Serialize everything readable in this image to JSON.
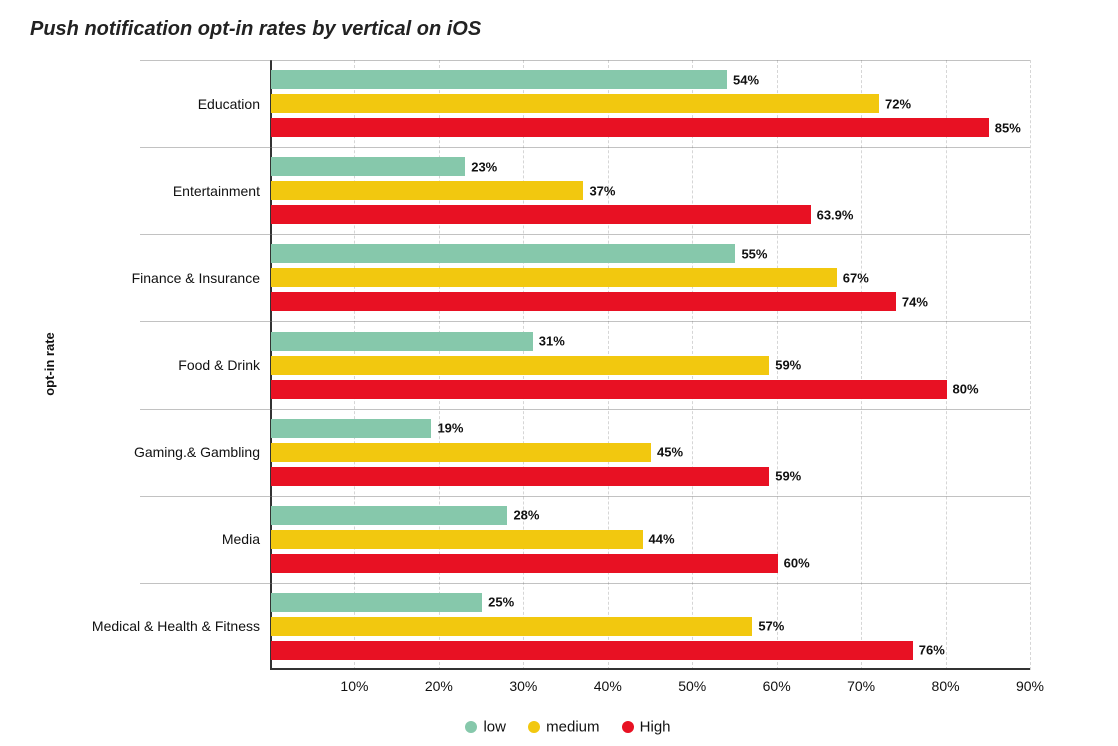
{
  "chart_data": {
    "type": "bar",
    "orientation": "horizontal",
    "title": "Push notification opt-in rates by vertical on iOS",
    "xlabel": "",
    "ylabel": "opt-in rate",
    "xlim": [
      0,
      90
    ],
    "xticks": [
      10,
      20,
      30,
      40,
      50,
      60,
      70,
      80,
      90
    ],
    "xtick_labels": [
      "10%",
      "20%",
      "30%",
      "40%",
      "50%",
      "60%",
      "70%",
      "80%",
      "90%"
    ],
    "series_meta": [
      {
        "key": "low",
        "name": "low",
        "color": "#86c8ab"
      },
      {
        "key": "medium",
        "name": "medium",
        "color": "#f2c80f"
      },
      {
        "key": "high",
        "name": "High",
        "color": "#e81123"
      }
    ],
    "categories": [
      {
        "name": "Education",
        "values": {
          "low": 54,
          "medium": 72,
          "high": 85
        },
        "labels": {
          "low": "54%",
          "medium": "72%",
          "high": "85%"
        }
      },
      {
        "name": "Entertainment",
        "values": {
          "low": 23,
          "medium": 37,
          "high": 63.9
        },
        "labels": {
          "low": "23%",
          "medium": "37%",
          "high": "63.9%"
        }
      },
      {
        "name": "Finance & Insurance",
        "values": {
          "low": 55,
          "medium": 67,
          "high": 74
        },
        "labels": {
          "low": "55%",
          "medium": "67%",
          "high": "74%"
        }
      },
      {
        "name": "Food & Drink",
        "values": {
          "low": 31,
          "medium": 59,
          "high": 80
        },
        "labels": {
          "low": "31%",
          "medium": "59%",
          "high": "80%"
        }
      },
      {
        "name": "Gaming.& Gambling",
        "values": {
          "low": 19,
          "medium": 45,
          "high": 59
        },
        "labels": {
          "low": "19%",
          "medium": "45%",
          "high": "59%"
        }
      },
      {
        "name": "Media",
        "values": {
          "low": 28,
          "medium": 44,
          "high": 60
        },
        "labels": {
          "low": "28%",
          "medium": "44%",
          "high": "60%"
        }
      },
      {
        "name": "Medical & Health & Fitness",
        "values": {
          "low": 25,
          "medium": 57,
          "high": 76
        },
        "labels": {
          "low": "25%",
          "medium": "57%",
          "high": "76%"
        }
      }
    ]
  }
}
